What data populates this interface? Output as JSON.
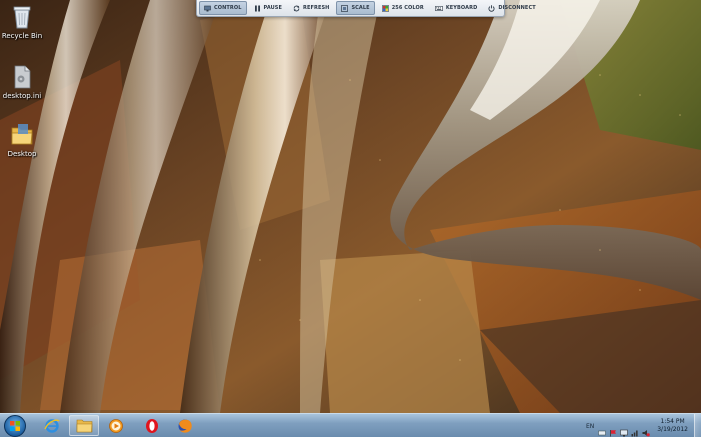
{
  "desktop": {
    "icons": [
      {
        "label": "Recycle Bin",
        "icon": "recycle-bin-icon"
      },
      {
        "label": "desktop.ini",
        "icon": "file-icon"
      },
      {
        "label": "Desktop",
        "icon": "folder-icon"
      }
    ]
  },
  "remote_toolbar": {
    "buttons": [
      {
        "label": "CONTROL",
        "icon": "control-icon",
        "active": true
      },
      {
        "label": "PAUSE",
        "icon": "pause-icon",
        "active": false
      },
      {
        "label": "REFRESH",
        "icon": "refresh-icon",
        "active": false
      },
      {
        "label": "SCALE",
        "icon": "scale-icon",
        "active": true
      },
      {
        "label": "256 COLOR",
        "icon": "color-icon",
        "active": false
      },
      {
        "label": "KEYBOARD",
        "icon": "keyboard-icon",
        "active": false
      },
      {
        "label": "DISCONNECT",
        "icon": "power-icon",
        "active": false
      }
    ]
  },
  "taskbar": {
    "apps": [
      {
        "name": "Internet Explorer",
        "icon": "internet-explorer-icon"
      },
      {
        "name": "Windows Explorer",
        "icon": "folder-icon"
      },
      {
        "name": "Media Player",
        "icon": "media-player-icon"
      },
      {
        "name": "Opera",
        "icon": "opera-icon"
      },
      {
        "name": "Firefox",
        "icon": "firefox-icon"
      }
    ],
    "tray": {
      "language": "EN",
      "time": "1:54 PM",
      "date": "3/19/2012"
    }
  },
  "colors": {
    "taskbar": "#7f9fbf",
    "toolbar_bg": "#e6ebf1",
    "toolbar_text": "#2e3a48"
  }
}
